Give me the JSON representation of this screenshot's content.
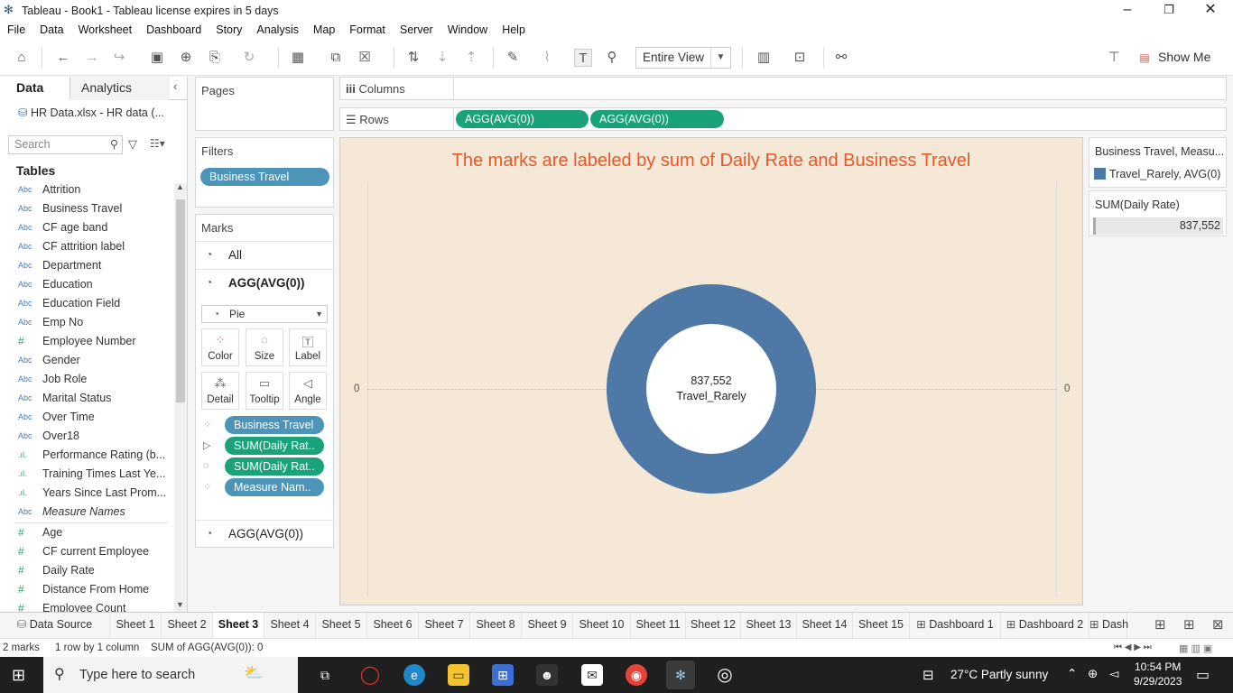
{
  "window": {
    "title": "Tableau - Book1 - Tableau license expires in 5 days",
    "controls": [
      "minimize",
      "restore",
      "close"
    ]
  },
  "menu": [
    "File",
    "Data",
    "Worksheet",
    "Dashboard",
    "Story",
    "Analysis",
    "Map",
    "Format",
    "Server",
    "Window",
    "Help"
  ],
  "toolbar": {
    "view_mode": "Entire View",
    "show_me": "Show Me"
  },
  "left_pane": {
    "tabs": [
      "Data",
      "Analytics"
    ],
    "data_source": "HR Data.xlsx - HR data (...",
    "search_placeholder": "Search",
    "tables_heading": "Tables",
    "fields": [
      {
        "type": "Abc",
        "name": "Attrition"
      },
      {
        "type": "Abc",
        "name": "Business Travel"
      },
      {
        "type": "Abc",
        "name": "CF age band"
      },
      {
        "type": "Abc",
        "name": "CF attrition label"
      },
      {
        "type": "Abc",
        "name": "Department"
      },
      {
        "type": "Abc",
        "name": "Education"
      },
      {
        "type": "Abc",
        "name": "Education Field"
      },
      {
        "type": "Abc",
        "name": "Emp No"
      },
      {
        "type": "#",
        "name": "Employee Number"
      },
      {
        "type": "Abc",
        "name": "Gender"
      },
      {
        "type": "Abc",
        "name": "Job Role"
      },
      {
        "type": "Abc",
        "name": "Marital Status"
      },
      {
        "type": "Abc",
        "name": "Over Time"
      },
      {
        "type": "Abc",
        "name": "Over18"
      },
      {
        "type": ".ıl.",
        "name": "Performance Rating (b..."
      },
      {
        "type": ".ıl.",
        "name": "Training Times Last Ye..."
      },
      {
        "type": ".ıl.",
        "name": "Years Since Last Prom..."
      },
      {
        "type": "Abc",
        "name": "Measure Names"
      },
      {
        "type": "#",
        "name": "Age"
      },
      {
        "type": "#",
        "name": "CF current Employee"
      },
      {
        "type": "#",
        "name": "Daily Rate"
      },
      {
        "type": "#",
        "name": "Distance From Home"
      },
      {
        "type": "#",
        "name": "Employee Count"
      }
    ]
  },
  "cards": {
    "pages": "Pages",
    "filters": {
      "title": "Filters",
      "pills": [
        "Business Travel"
      ]
    },
    "marks": {
      "title": "Marks",
      "all": "All",
      "layer1": "AGG(AVG(0))",
      "mark_type": "Pie",
      "buttons": [
        "Color",
        "Size",
        "Label",
        "Detail",
        "Tooltip",
        "Angle"
      ],
      "pills": [
        "Business Travel",
        "SUM(Daily Rat..",
        "SUM(Daily Rat..",
        "Measure Nam.."
      ],
      "layer2": "AGG(AVG(0))"
    }
  },
  "shelves": {
    "columns_label": "Columns",
    "rows_label": "Rows",
    "rows_pills": [
      "AGG(AVG(0))",
      "AGG(AVG(0))"
    ]
  },
  "viz": {
    "title": "The marks are labeled by sum of Daily Rate and Business Travel",
    "axis_left": "0",
    "axis_right": "0",
    "center_value": "837,552",
    "center_label": "Travel_Rarely",
    "colors": {
      "ring": "#4e79a7",
      "hole": "#ffffff",
      "bg": "#f5e8d7",
      "title": "#e8582a"
    }
  },
  "chart_data": {
    "type": "pie",
    "title": "The marks are labeled by sum of Daily Rate and Business Travel",
    "slices": [
      {
        "label": "Travel_Rarely",
        "value": 837552,
        "color": "#4e79a7"
      }
    ],
    "donut": true
  },
  "legends": {
    "color_title": "Business Travel, Measu...",
    "color_item": "Travel_Rarely, AVG(0)",
    "size_title": "SUM(Daily Rate)",
    "size_value": "837,552"
  },
  "sheet_tabs": [
    "Data Source",
    "Sheet 1",
    "Sheet 2",
    "Sheet 3",
    "Sheet 4",
    "Sheet 5",
    "Sheet 6",
    "Sheet 7",
    "Sheet 8",
    "Sheet 9",
    "Sheet 10",
    "Sheet 11",
    "Sheet 12",
    "Sheet 13",
    "Sheet 14",
    "Sheet 15",
    "Dashboard 1",
    "Dashboard 2",
    "Dash"
  ],
  "active_sheet": "Sheet 3",
  "status": {
    "marks": "2 marks",
    "dims": "1 row by 1 column",
    "sum": "SUM of AGG(AVG(0)): 0"
  },
  "taskbar": {
    "search_placeholder": "Type here to search",
    "weather": "27°C  Partly sunny",
    "time": "10:54 PM",
    "date": "9/29/2023"
  }
}
